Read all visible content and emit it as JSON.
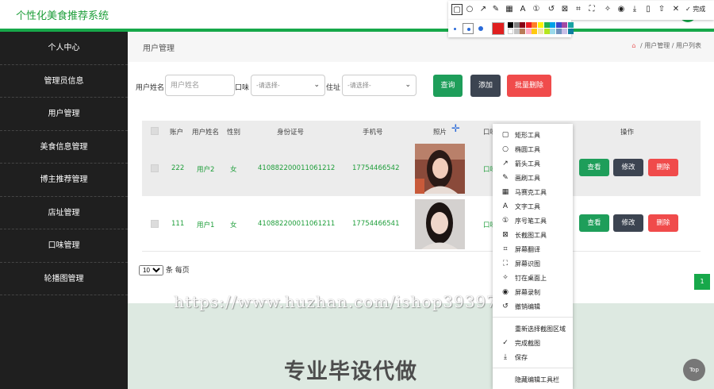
{
  "app": {
    "title": "个性化美食推荐系统"
  },
  "sidebar": {
    "items": [
      {
        "label": "个人中心"
      },
      {
        "label": "管理员信息"
      },
      {
        "label": "用户管理"
      },
      {
        "label": "美食信息管理"
      },
      {
        "label": "博主推荐管理"
      },
      {
        "label": "店址管理"
      },
      {
        "label": "口味管理"
      },
      {
        "label": "轮播图管理"
      }
    ]
  },
  "page": {
    "title": "用户管理",
    "breadcrumb": [
      "用户管理",
      "用户列表"
    ],
    "breadcrumb_sep": "/"
  },
  "filters": {
    "name_label": "用户姓名",
    "name_placeholder": "用户姓名",
    "taste_label": "口味",
    "taste_value": "-请选择-",
    "address_label": "住址",
    "address_value": "-请选择-",
    "query_label": "查询",
    "add_label": "添加",
    "batch_delete_label": "批量删除"
  },
  "table": {
    "headers": [
      "账户",
      "用户姓名",
      "性别",
      "身份证号",
      "手机号",
      "照片",
      "口味",
      "操作"
    ],
    "rows": [
      {
        "account": "222",
        "name": "用户2",
        "gender": "女",
        "id_number": "410882200011061212",
        "phone": "17754466542",
        "taste": "口味"
      },
      {
        "account": "111",
        "name": "用户1",
        "gender": "女",
        "id_number": "410882200011061211",
        "phone": "17754466541",
        "taste": "口味"
      }
    ],
    "actions": {
      "view": "查看",
      "edit": "修改",
      "delete": "删除"
    }
  },
  "pagination": {
    "page_size": "10",
    "per_page_label": "条 每页",
    "current_page": "1"
  },
  "watermark": {
    "url": "https://www.huzhan.com/ishop39397",
    "text": "专业毕设代做"
  },
  "back_to_top": "Top",
  "screenshot_tool": {
    "done_label": "完成",
    "menu": [
      {
        "label": "矩形工具",
        "icon": "rectangle-icon"
      },
      {
        "label": "椭圆工具",
        "icon": "ellipse-icon"
      },
      {
        "label": "箭头工具",
        "icon": "arrow-icon"
      },
      {
        "label": "画刷工具",
        "icon": "brush-icon"
      },
      {
        "label": "马赛克工具",
        "icon": "mosaic-icon"
      },
      {
        "label": "文字工具",
        "icon": "text-icon"
      },
      {
        "label": "序号笔工具",
        "icon": "number-icon"
      },
      {
        "label": "长截图工具",
        "icon": "long-screenshot-icon"
      },
      {
        "label": "屏幕翻译",
        "icon": "translate-icon"
      },
      {
        "label": "屏幕识图",
        "icon": "recognize-icon"
      },
      {
        "label": "钉在桌面上",
        "icon": "pin-icon"
      },
      {
        "label": "屏幕录制",
        "icon": "record-icon"
      },
      {
        "label": "撤销编辑",
        "icon": "undo-icon"
      },
      {
        "label": "重新选择截图区域",
        "icon": ""
      },
      {
        "label": "完成截图",
        "icon": "check-icon"
      },
      {
        "label": "保存",
        "icon": "download-icon"
      },
      {
        "label": "隐藏编辑工具栏",
        "icon": ""
      }
    ],
    "colors": {
      "current": "#e02020",
      "row1": [
        "#000000",
        "#7f7f7f",
        "#880015",
        "#ed1c24",
        "#ff7f27",
        "#fff200",
        "#22b14c",
        "#00a2e8",
        "#3f48cc",
        "#a349a4",
        "#19a3a3"
      ],
      "row2": [
        "#ffffff",
        "#c3c3c3",
        "#b97a57",
        "#ffaec9",
        "#ffc90e",
        "#efe4b0",
        "#b5e61d",
        "#99d9ea",
        "#7092be",
        "#c8bfe7",
        "#0e7ea0"
      ]
    }
  },
  "colors": {
    "accent": "#17a84a",
    "danger": "#f04b4b",
    "dark_button": "#3c4451",
    "sidebar_bg": "#1f1f1f"
  }
}
